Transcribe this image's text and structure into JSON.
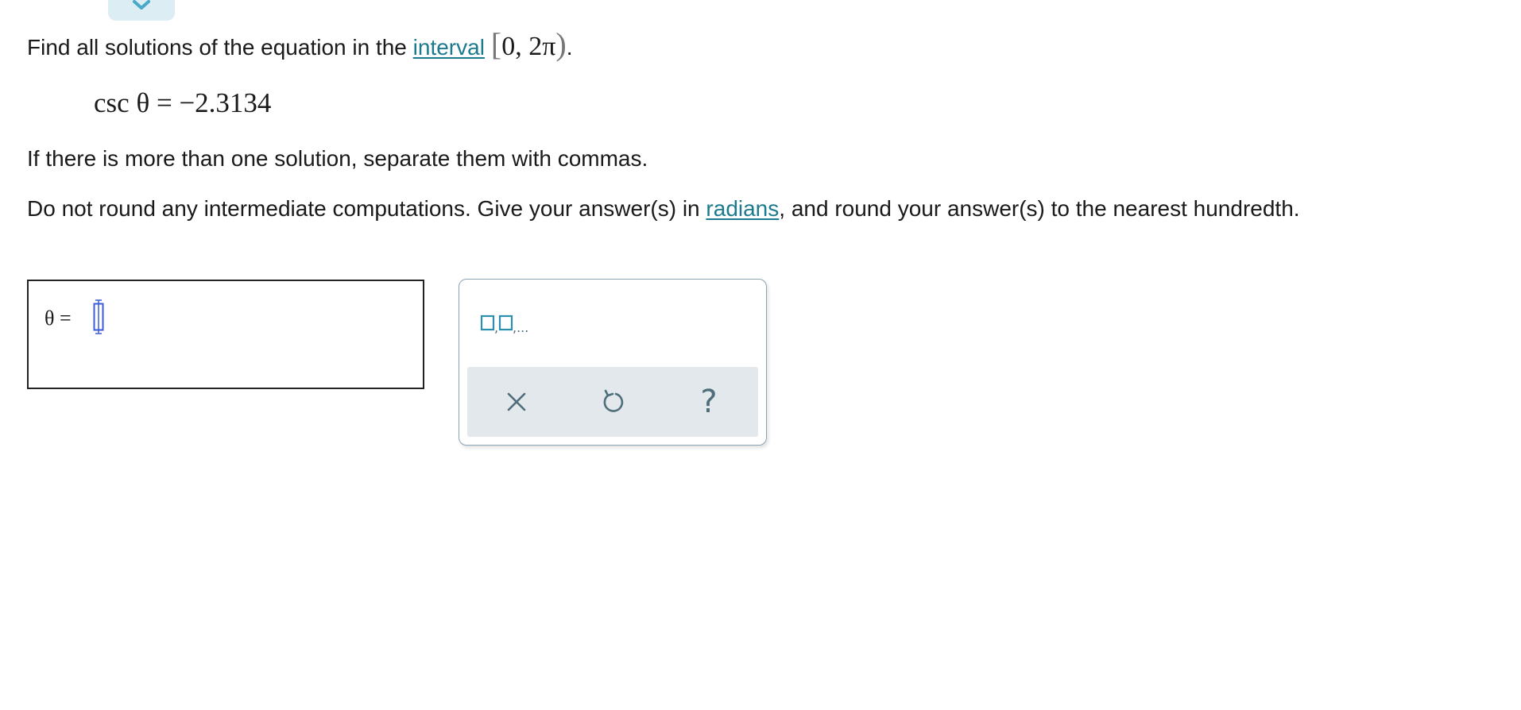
{
  "question": {
    "intro_text": "Find all solutions of the equation in the ",
    "interval_link": "interval",
    "interval_open": "[",
    "interval_body": "0, 2π",
    "interval_close": ")",
    "interval_period": ".",
    "equation": "csc θ = −2.3134",
    "separate_instruction": "If there is more than one solution, separate them with commas.",
    "round_text_before": "Do not round any intermediate computations. Give your answer(s) in ",
    "radians_link": "radians",
    "round_text_after": ", and round your answer(s) to the nearest hundredth."
  },
  "answer": {
    "label": "θ =",
    "value": ""
  },
  "toolbar": {
    "list_template_icon": "comma-separated-list-icon",
    "clear_icon": "close-icon",
    "undo_icon": "undo-icon",
    "help_label": "?"
  },
  "colors": {
    "link": "#1c7a8e",
    "icon": "#4f6e7b",
    "template_icon": "#2b8fb0",
    "cursor": "#3b5bdb",
    "toolbar_bg": "#e2e8eb",
    "panel_border": "#8aa6b3",
    "top_tab_bg": "#dcedf3"
  }
}
